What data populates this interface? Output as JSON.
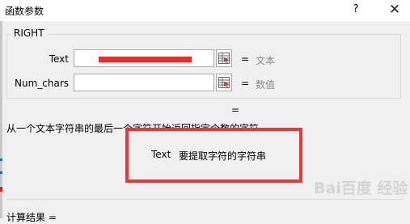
{
  "window": {
    "title": "函数参数",
    "help_label": "?",
    "close_label": "✕"
  },
  "function": {
    "name": "RIGHT"
  },
  "arguments": [
    {
      "label": "Text",
      "value": "",
      "result_eq": "=",
      "result_hint": "文本"
    },
    {
      "label": "Num_chars",
      "value": "",
      "result_eq": "=",
      "result_hint": "数值"
    }
  ],
  "formula_result_eq": "=",
  "description": "从一个文本字符串的最后一个字符开始返回指定个数的字符",
  "argument_detail": {
    "name": "Text",
    "text": "要提取字符的字符串"
  },
  "result_label": "计算结果 =",
  "watermark": "Bai百度 经验",
  "colors": {
    "highlight_border": "#e03a3a",
    "filled_bar": "#ee2a2a",
    "hint": "#8a8a8a"
  },
  "icons": [
    "collapse-dialog-icon",
    "help-icon",
    "close-icon"
  ]
}
